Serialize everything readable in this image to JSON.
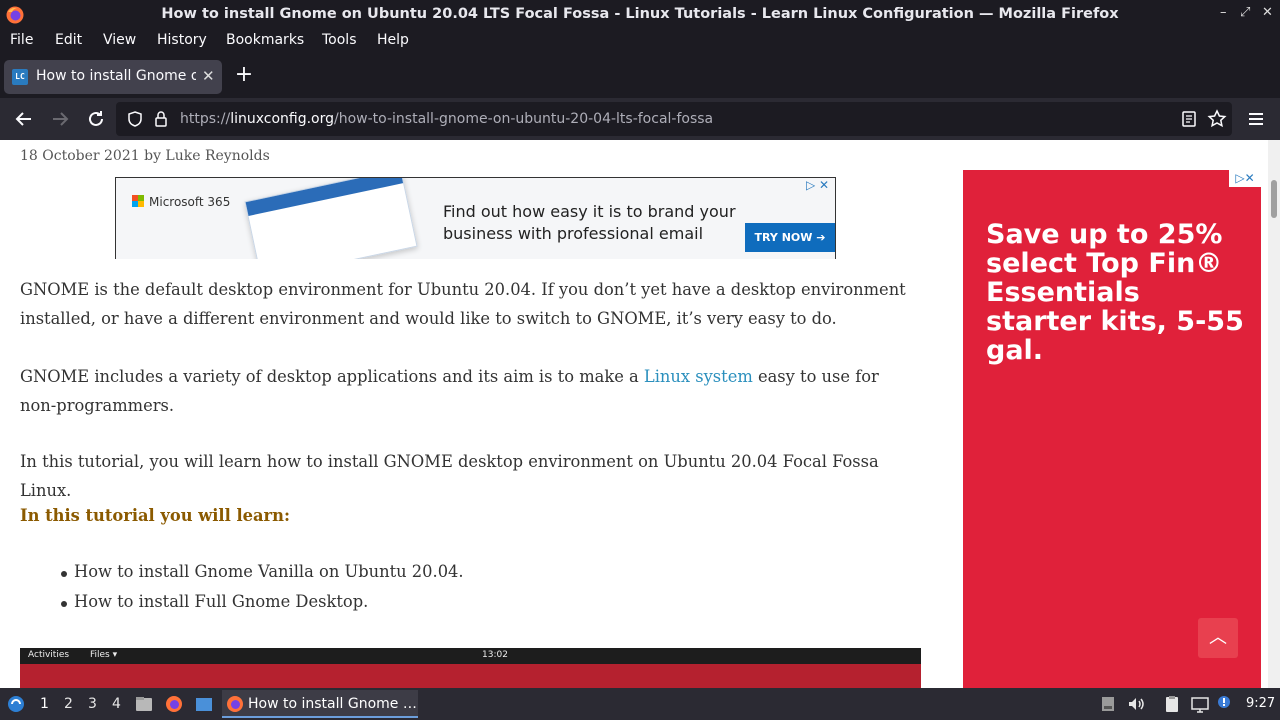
{
  "window": {
    "title": "How to install Gnome on Ubuntu 20.04 LTS Focal Fossa - Linux Tutorials - Learn Linux Configuration — Mozilla Firefox",
    "controls": [
      "–",
      "⤢",
      "✕"
    ]
  },
  "menu": {
    "items": [
      "File",
      "Edit",
      "View",
      "History",
      "Bookmarks",
      "Tools",
      "Help"
    ]
  },
  "tab": {
    "label": "How to install Gnome on Ubuntu 20.04 LTS Focal Fossa",
    "favicon_text": "LC",
    "close": "✕",
    "new_tab": "+"
  },
  "nav": {
    "url_scheme": "https://",
    "url_host": "linuxconfig.org",
    "url_path": "/how-to-install-gnome-on-ubuntu-20-04-lts-focal-fossa"
  },
  "article": {
    "byline": "18 October 2021 by Luke Reynolds",
    "p1": "GNOME is the default desktop environment for Ubuntu 20.04. If you don’t yet have a desktop environment installed, or have a different environment and would like to switch to GNOME, it’s very easy to do.",
    "p2_before": "GNOME includes a variety of desktop applications and its aim is to make a ",
    "p2_link": "Linux system",
    "p2_after": " easy to use for non-programmers.",
    "p3": "In this tutorial, you will learn how to install GNOME desktop environment on Ubuntu 20.04 Focal Fossa Linux.",
    "learn_heading": "In this tutorial you will learn:",
    "learn_items": [
      "How to install Gnome Vanilla on Ubuntu 20.04.",
      "How to install Full Gnome Desktop."
    ],
    "screenshot": {
      "activities": "Activities",
      "files": "Files ▾",
      "time": "13:02"
    }
  },
  "ad_banner": {
    "brand": "Microsoft 365",
    "line1": "Find out how easy it is to brand your",
    "line2": "business with professional email",
    "cta": "TRY NOW ➔",
    "choices": "▷ ✕"
  },
  "ad_side": {
    "copy": "Save up to 25% select Top Fin® Essentials starter kits, 5-55 gal.",
    "choices": "▷✕",
    "bg_color": "#e0213a"
  },
  "scroll_top": "︿",
  "taskbar": {
    "workspaces": [
      "1",
      "2",
      "3",
      "4"
    ],
    "active_window": "How to install Gnome …",
    "clock": "9:27"
  }
}
